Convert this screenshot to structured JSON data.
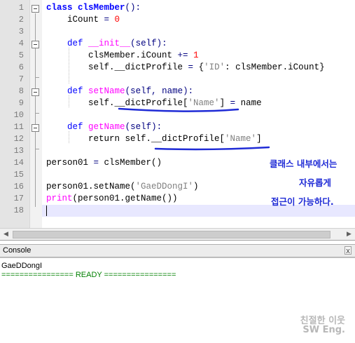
{
  "editor": {
    "line_numbers": [
      "1",
      "2",
      "3",
      "4",
      "5",
      "6",
      "7",
      "8",
      "9",
      "10",
      "11",
      "12",
      "13",
      "14",
      "15",
      "16",
      "17",
      "18"
    ],
    "lines": [
      [
        {
          "t": "class",
          "c": "kw"
        },
        {
          "t": " "
        },
        {
          "t": "clsMember",
          "c": "kw"
        },
        {
          "t": "():",
          "c": "op"
        }
      ],
      [
        {
          "t": "    iCount "
        },
        {
          "t": "=",
          "c": "op"
        },
        {
          "t": " "
        },
        {
          "t": "0",
          "c": "num"
        }
      ],
      [],
      [
        {
          "t": "    "
        },
        {
          "t": "def",
          "c": "def"
        },
        {
          "t": " "
        },
        {
          "t": "__init__",
          "c": "fn"
        },
        {
          "t": "(self):",
          "c": "op"
        }
      ],
      [
        {
          "t": "        clsMember.iCount "
        },
        {
          "t": "+=",
          "c": "op"
        },
        {
          "t": " "
        },
        {
          "t": "1",
          "c": "num"
        }
      ],
      [
        {
          "t": "        self.__dictProfile "
        },
        {
          "t": "=",
          "c": "op"
        },
        {
          "t": " {"
        },
        {
          "t": "'ID'",
          "c": "str"
        },
        {
          "t": ": clsMember.iCount}"
        }
      ],
      [],
      [
        {
          "t": "    "
        },
        {
          "t": "def",
          "c": "def"
        },
        {
          "t": " "
        },
        {
          "t": "setName",
          "c": "fn"
        },
        {
          "t": "(self, name):",
          "c": "op"
        }
      ],
      [
        {
          "t": "        self.__dictProfile["
        },
        {
          "t": "'Name'",
          "c": "str"
        },
        {
          "t": "] "
        },
        {
          "t": "=",
          "c": "op"
        },
        {
          "t": " name"
        }
      ],
      [],
      [
        {
          "t": "    "
        },
        {
          "t": "def",
          "c": "def"
        },
        {
          "t": " "
        },
        {
          "t": "getName",
          "c": "fn"
        },
        {
          "t": "(self):",
          "c": "op"
        }
      ],
      [
        {
          "t": "        return self.__dictProfile["
        },
        {
          "t": "'Name'",
          "c": "str"
        },
        {
          "t": "]"
        }
      ],
      [],
      [
        {
          "t": "person01 "
        },
        {
          "t": "=",
          "c": "op"
        },
        {
          "t": " clsMember()"
        }
      ],
      [],
      [
        {
          "t": "person01.setName("
        },
        {
          "t": "'GaeDDongI'",
          "c": "str"
        },
        {
          "t": ")"
        }
      ],
      [
        {
          "t": "print",
          "c": "fn"
        },
        {
          "t": "(person01.getName())"
        }
      ],
      []
    ]
  },
  "annotation": {
    "line1": "클래스 내부에서는",
    "line2": "자유롭게",
    "line3": "접근이 가능하다.",
    "color": "#1f2bd6"
  },
  "console": {
    "title": "Console",
    "close_label": "x",
    "output": "GaeDDongI",
    "status": "================ READY ================",
    "status_color": "#008000"
  },
  "watermark": {
    "line1": "친절한 이웃",
    "line2": "SW Eng."
  }
}
